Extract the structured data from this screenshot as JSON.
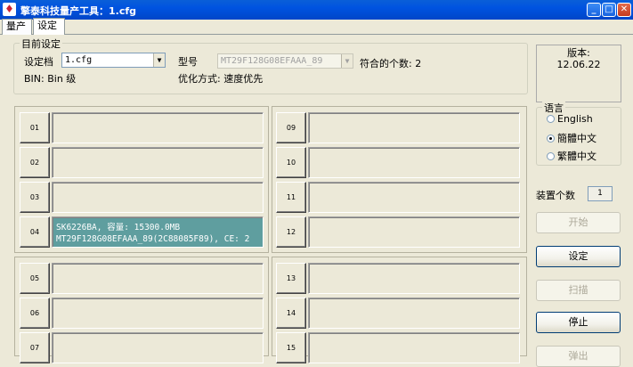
{
  "window": {
    "title": "擎泰科技量产工具：1.cfg",
    "buttons": {
      "minimize": "_",
      "maximize": "□",
      "close": "✕"
    }
  },
  "tabs": [
    {
      "label": "量产"
    },
    {
      "label": "设定"
    }
  ],
  "settings": {
    "group_title": "目前设定",
    "config_label": "设定档",
    "config_value": "1.cfg",
    "model_label": "型号",
    "model_value": "MT29F128G08EFAAA_89",
    "match_label": "符合的个数: 2",
    "bin_label": "BIN: Bin 级",
    "optimize_label": "优化方式: 速度优先"
  },
  "ports_left": [
    {
      "num": "01",
      "info1": "",
      "info2": ""
    },
    {
      "num": "02",
      "info1": "",
      "info2": ""
    },
    {
      "num": "03",
      "info1": "",
      "info2": ""
    },
    {
      "num": "04",
      "info1": "SK6226BA, 容量: 15300.0MB",
      "info2": "MT29F128G08EFAAA_89(2C88085F89), CE: 2",
      "active": true
    },
    {
      "num": "05",
      "info1": "",
      "info2": ""
    },
    {
      "num": "06",
      "info1": "",
      "info2": ""
    },
    {
      "num": "07",
      "info1": "",
      "info2": ""
    }
  ],
  "ports_right": [
    {
      "num": "09"
    },
    {
      "num": "10"
    },
    {
      "num": "11"
    },
    {
      "num": "12"
    },
    {
      "num": "13"
    },
    {
      "num": "14"
    },
    {
      "num": "15"
    }
  ],
  "version": {
    "label": "版本:",
    "value": "12.06.22"
  },
  "language": {
    "title": "语言",
    "options": [
      {
        "label": "English",
        "selected": false
      },
      {
        "label": "簡體中文",
        "selected": true
      },
      {
        "label": "繁體中文",
        "selected": false
      }
    ]
  },
  "device_count": {
    "label": "装置个数",
    "value": "1"
  },
  "buttons": [
    {
      "label": "开始",
      "enabled": false
    },
    {
      "label": "设定",
      "enabled": true
    },
    {
      "label": "扫描",
      "enabled": false
    },
    {
      "label": "停止",
      "enabled": true
    },
    {
      "label": "弹出",
      "enabled": false
    }
  ]
}
